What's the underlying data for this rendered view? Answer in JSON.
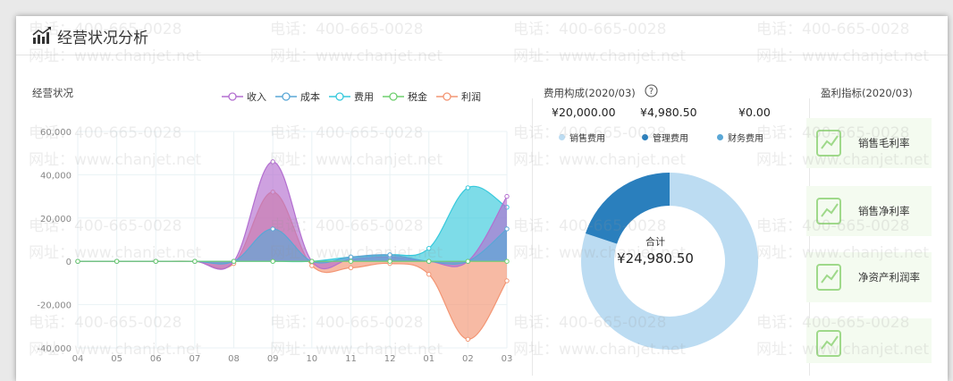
{
  "header": {
    "title": "经营状况分析"
  },
  "sections": {
    "operating": "经营状况",
    "cost": "费用构成(2020/03)",
    "profit": "盈利指标(2020/03)"
  },
  "chart_data": [
    {
      "type": "area",
      "categories": [
        "04",
        "05",
        "06",
        "07",
        "08",
        "09",
        "10",
        "11",
        "12",
        "01",
        "02",
        "03"
      ],
      "ylim": [
        -40000,
        60000
      ],
      "yticks": [
        "60,000",
        "40,000",
        "20,000",
        "0",
        "-20,000",
        "-40,000"
      ],
      "series": [
        {
          "name": "收入",
          "color": "#b36fd0",
          "values": [
            0,
            0,
            0,
            0,
            0,
            46000,
            0,
            1000,
            2000,
            0,
            0,
            30000
          ]
        },
        {
          "name": "成本",
          "color": "#5aa7d6",
          "values": [
            0,
            0,
            0,
            0,
            0,
            15000,
            0,
            2000,
            3000,
            0,
            0,
            15000
          ]
        },
        {
          "name": "费用",
          "color": "#37c9dc",
          "values": [
            0,
            0,
            0,
            0,
            0,
            0,
            0,
            2000,
            3000,
            6000,
            34000,
            25000
          ]
        },
        {
          "name": "税金",
          "color": "#6fcf6f",
          "values": [
            0,
            0,
            0,
            0,
            0,
            0,
            0,
            0,
            0,
            0,
            0,
            0
          ]
        },
        {
          "name": "利润",
          "color": "#f39573",
          "values": [
            0,
            0,
            0,
            0,
            -1000,
            32000,
            -2000,
            -3000,
            -1000,
            -6000,
            -36000,
            -9000
          ]
        }
      ]
    },
    {
      "type": "pie",
      "series": [
        {
          "name": "销售费用",
          "value": 20000.0,
          "display": "¥20,000.00",
          "color": "#bcdcf2"
        },
        {
          "name": "管理费用",
          "value": 4980.5,
          "display": "¥4,980.50",
          "color": "#2a7fbd"
        },
        {
          "name": "财务费用",
          "value": 0.0,
          "display": "¥0.00",
          "color": "#5aa7d6"
        }
      ],
      "total_label": "合计",
      "total": "¥24,980.50"
    }
  ],
  "profit_items": [
    "销售毛利率",
    "销售净利率",
    "净资产利润率"
  ],
  "watermark": {
    "phone": "电话：400-665-0028",
    "site": "网址：www.chanjet.net"
  },
  "colors": {
    "accent": "#2a7fbd",
    "profit_card": "#f4fbf0"
  }
}
